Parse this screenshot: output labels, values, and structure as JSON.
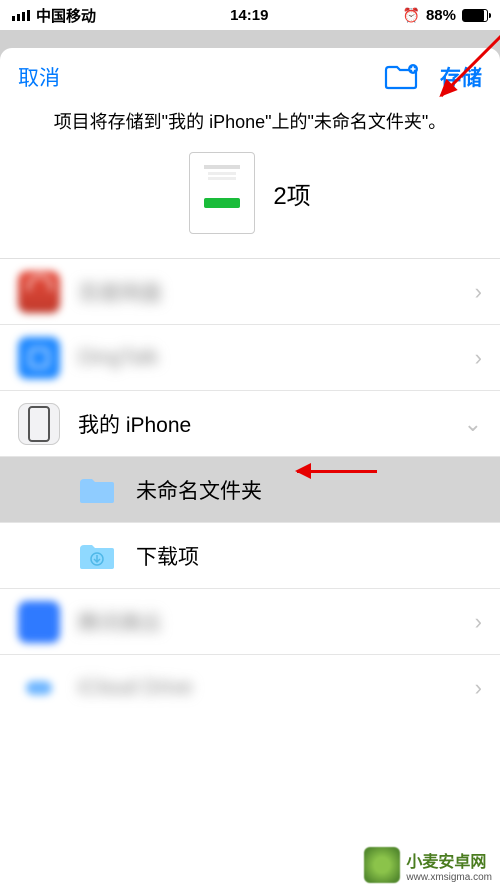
{
  "status": {
    "carrier": "中国移动",
    "time": "14:19",
    "battery_pct": "88%"
  },
  "sheet": {
    "cancel": "取消",
    "save": "存储",
    "message": "项目将存储到\"我的 iPhone\"上的\"未命名文件夹\"。",
    "item_count": "2项"
  },
  "locations": [
    {
      "id": "baidu",
      "label": "百度网盘",
      "blurred": true,
      "chevron": "right"
    },
    {
      "id": "dingtalk",
      "label": "DingTalk",
      "blurred": true,
      "chevron": "right"
    },
    {
      "id": "myiphone",
      "label": "我的 iPhone",
      "blurred": false,
      "chevron": "down"
    },
    {
      "id": "unnamed",
      "label": "未命名文件夹",
      "blurred": false,
      "indent": true,
      "selected": true,
      "folder_color": "#7fc4ff"
    },
    {
      "id": "downloads",
      "label": "下载项",
      "blurred": false,
      "indent": true,
      "folder_color": "#7fd9ff"
    },
    {
      "id": "tencent",
      "label": "腾讯微云",
      "blurred": true,
      "chevron": "right"
    },
    {
      "id": "icloud",
      "label": "iCloud Drive",
      "blurred": true,
      "chevron": "right"
    }
  ],
  "watermark": {
    "title": "小麦安卓网",
    "url": "www.xmsigma.com"
  }
}
